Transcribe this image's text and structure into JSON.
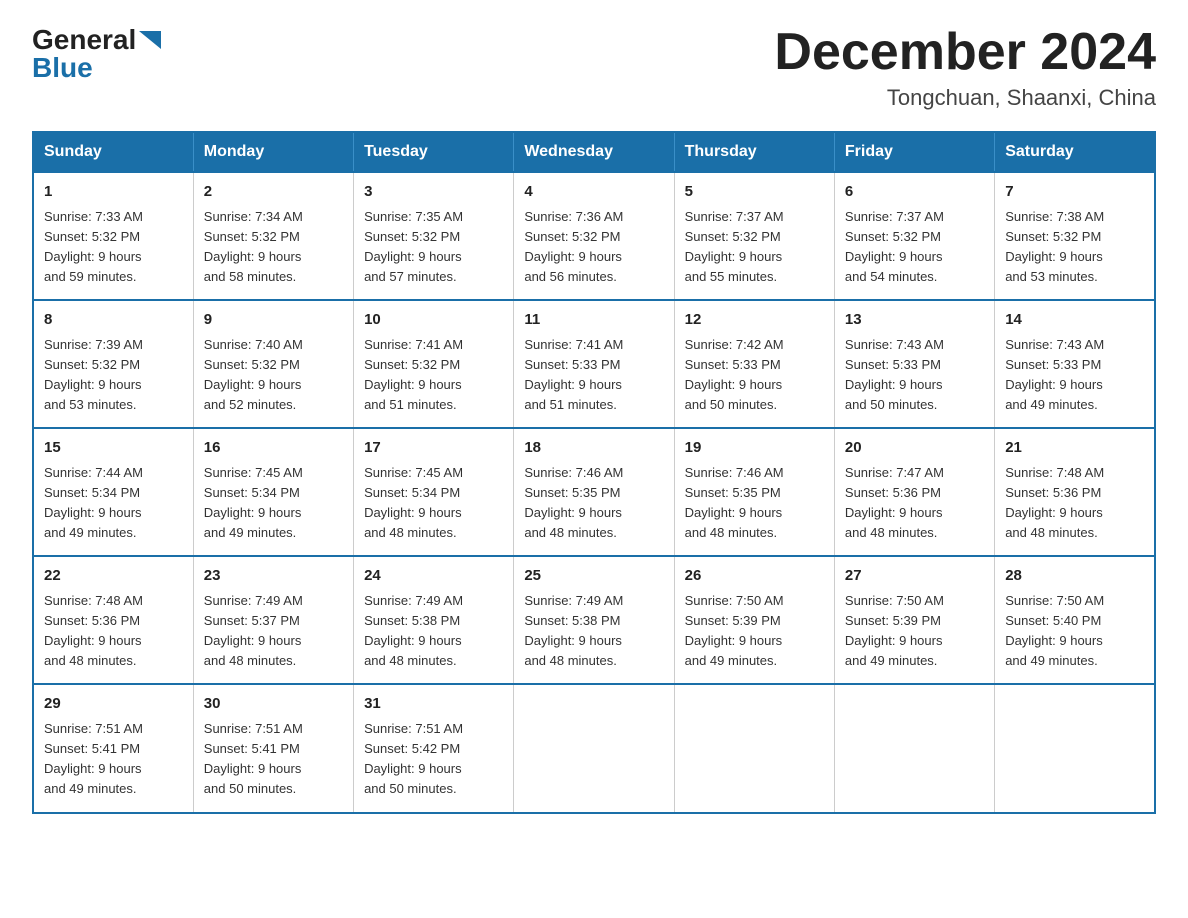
{
  "logo": {
    "general": "General",
    "blue": "Blue"
  },
  "title": "December 2024",
  "location": "Tongchuan, Shaanxi, China",
  "headers": [
    "Sunday",
    "Monday",
    "Tuesday",
    "Wednesday",
    "Thursday",
    "Friday",
    "Saturday"
  ],
  "weeks": [
    [
      {
        "day": "1",
        "sunrise": "7:33 AM",
        "sunset": "5:32 PM",
        "daylight": "9 hours and 59 minutes."
      },
      {
        "day": "2",
        "sunrise": "7:34 AM",
        "sunset": "5:32 PM",
        "daylight": "9 hours and 58 minutes."
      },
      {
        "day": "3",
        "sunrise": "7:35 AM",
        "sunset": "5:32 PM",
        "daylight": "9 hours and 57 minutes."
      },
      {
        "day": "4",
        "sunrise": "7:36 AM",
        "sunset": "5:32 PM",
        "daylight": "9 hours and 56 minutes."
      },
      {
        "day": "5",
        "sunrise": "7:37 AM",
        "sunset": "5:32 PM",
        "daylight": "9 hours and 55 minutes."
      },
      {
        "day": "6",
        "sunrise": "7:37 AM",
        "sunset": "5:32 PM",
        "daylight": "9 hours and 54 minutes."
      },
      {
        "day": "7",
        "sunrise": "7:38 AM",
        "sunset": "5:32 PM",
        "daylight": "9 hours and 53 minutes."
      }
    ],
    [
      {
        "day": "8",
        "sunrise": "7:39 AM",
        "sunset": "5:32 PM",
        "daylight": "9 hours and 53 minutes."
      },
      {
        "day": "9",
        "sunrise": "7:40 AM",
        "sunset": "5:32 PM",
        "daylight": "9 hours and 52 minutes."
      },
      {
        "day": "10",
        "sunrise": "7:41 AM",
        "sunset": "5:32 PM",
        "daylight": "9 hours and 51 minutes."
      },
      {
        "day": "11",
        "sunrise": "7:41 AM",
        "sunset": "5:33 PM",
        "daylight": "9 hours and 51 minutes."
      },
      {
        "day": "12",
        "sunrise": "7:42 AM",
        "sunset": "5:33 PM",
        "daylight": "9 hours and 50 minutes."
      },
      {
        "day": "13",
        "sunrise": "7:43 AM",
        "sunset": "5:33 PM",
        "daylight": "9 hours and 50 minutes."
      },
      {
        "day": "14",
        "sunrise": "7:43 AM",
        "sunset": "5:33 PM",
        "daylight": "9 hours and 49 minutes."
      }
    ],
    [
      {
        "day": "15",
        "sunrise": "7:44 AM",
        "sunset": "5:34 PM",
        "daylight": "9 hours and 49 minutes."
      },
      {
        "day": "16",
        "sunrise": "7:45 AM",
        "sunset": "5:34 PM",
        "daylight": "9 hours and 49 minutes."
      },
      {
        "day": "17",
        "sunrise": "7:45 AM",
        "sunset": "5:34 PM",
        "daylight": "9 hours and 48 minutes."
      },
      {
        "day": "18",
        "sunrise": "7:46 AM",
        "sunset": "5:35 PM",
        "daylight": "9 hours and 48 minutes."
      },
      {
        "day": "19",
        "sunrise": "7:46 AM",
        "sunset": "5:35 PM",
        "daylight": "9 hours and 48 minutes."
      },
      {
        "day": "20",
        "sunrise": "7:47 AM",
        "sunset": "5:36 PM",
        "daylight": "9 hours and 48 minutes."
      },
      {
        "day": "21",
        "sunrise": "7:48 AM",
        "sunset": "5:36 PM",
        "daylight": "9 hours and 48 minutes."
      }
    ],
    [
      {
        "day": "22",
        "sunrise": "7:48 AM",
        "sunset": "5:36 PM",
        "daylight": "9 hours and 48 minutes."
      },
      {
        "day": "23",
        "sunrise": "7:49 AM",
        "sunset": "5:37 PM",
        "daylight": "9 hours and 48 minutes."
      },
      {
        "day": "24",
        "sunrise": "7:49 AM",
        "sunset": "5:38 PM",
        "daylight": "9 hours and 48 minutes."
      },
      {
        "day": "25",
        "sunrise": "7:49 AM",
        "sunset": "5:38 PM",
        "daylight": "9 hours and 48 minutes."
      },
      {
        "day": "26",
        "sunrise": "7:50 AM",
        "sunset": "5:39 PM",
        "daylight": "9 hours and 49 minutes."
      },
      {
        "day": "27",
        "sunrise": "7:50 AM",
        "sunset": "5:39 PM",
        "daylight": "9 hours and 49 minutes."
      },
      {
        "day": "28",
        "sunrise": "7:50 AM",
        "sunset": "5:40 PM",
        "daylight": "9 hours and 49 minutes."
      }
    ],
    [
      {
        "day": "29",
        "sunrise": "7:51 AM",
        "sunset": "5:41 PM",
        "daylight": "9 hours and 49 minutes."
      },
      {
        "day": "30",
        "sunrise": "7:51 AM",
        "sunset": "5:41 PM",
        "daylight": "9 hours and 50 minutes."
      },
      {
        "day": "31",
        "sunrise": "7:51 AM",
        "sunset": "5:42 PM",
        "daylight": "9 hours and 50 minutes."
      },
      null,
      null,
      null,
      null
    ]
  ],
  "labels": {
    "sunrise": "Sunrise:",
    "sunset": "Sunset:",
    "daylight": "Daylight:"
  }
}
